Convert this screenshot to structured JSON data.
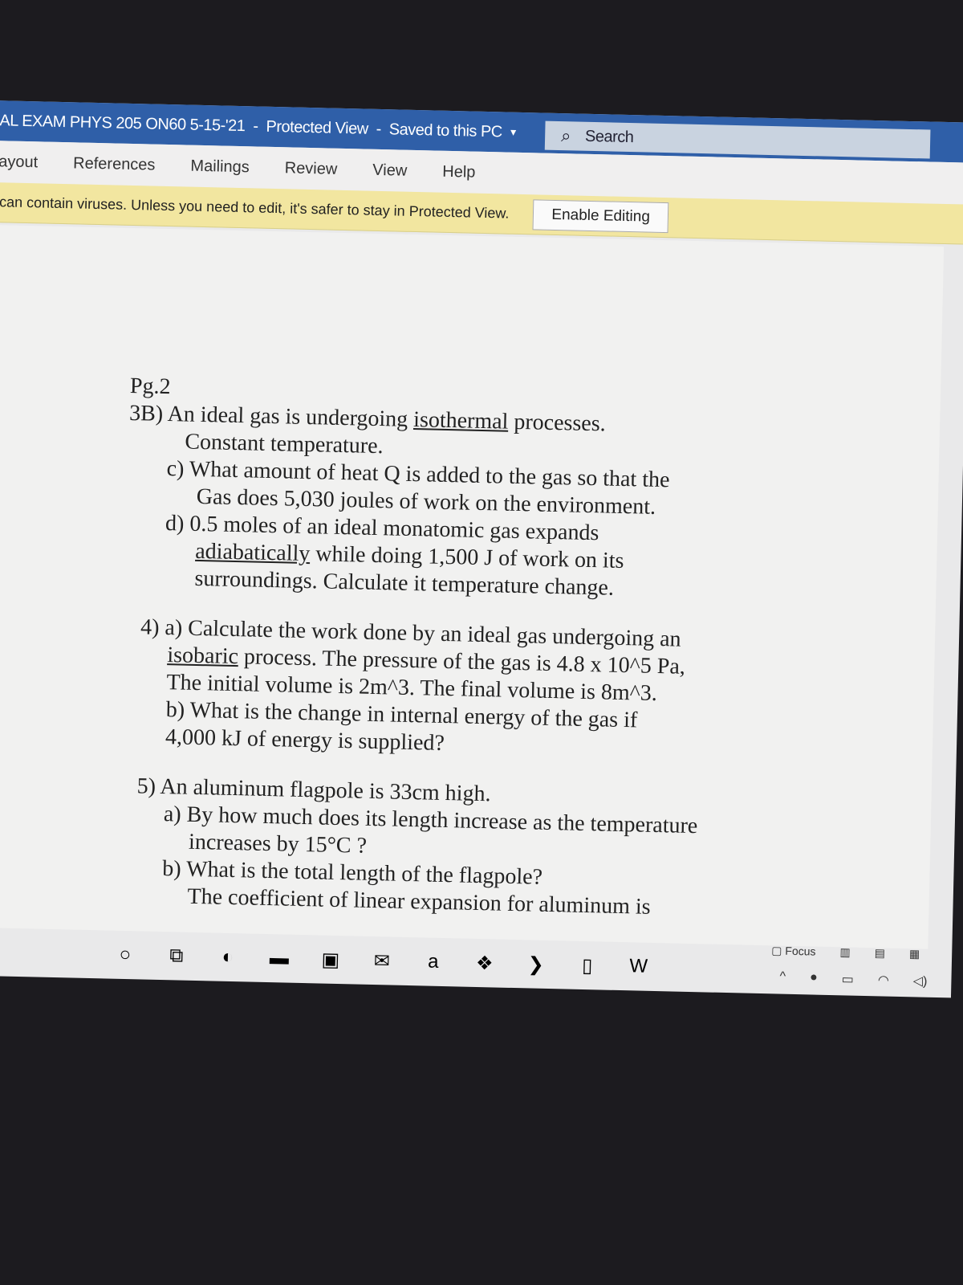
{
  "window": {
    "title": "AL EXAM PHYS 205 ON60 5-15-'21",
    "mode": "Protected View",
    "save_status": "Saved to this PC",
    "search_label": "Search"
  },
  "tabs": [
    "ayout",
    "References",
    "Mailings",
    "Review",
    "View",
    "Help"
  ],
  "protected_bar": {
    "message": "can contain viruses. Unless you need to edit, it's safer to stay in Protected View.",
    "button": "Enable Editing"
  },
  "document": {
    "lines": [
      {
        "t": "Pg.2",
        "c": ""
      },
      {
        "t": "3B) An ideal gas is undergoing isothermal processes.",
        "c": ""
      },
      {
        "t": "Constant temperature.",
        "c": "i1"
      },
      {
        "t": "c) What amount of heat Q is added to the gas so that the",
        "c": "i2"
      },
      {
        "t": "Gas does 5,030 joules of work on the environment.",
        "c": "i3"
      },
      {
        "t": "d) 0.5 moles of an ideal monatomic gas expands",
        "c": "i2"
      },
      {
        "t": "adiabatically while doing 1,500 J of work on its",
        "c": "i3"
      },
      {
        "t": "surroundings. Calculate it temperature change.",
        "c": "i3"
      },
      {
        "t": "",
        "c": "gap"
      },
      {
        "t": "4) a) Calculate the work done by an ideal gas undergoing an",
        "c": "i4"
      },
      {
        "t": "isobaric process. The pressure of the gas is 4.8 x 10^5 Pa,",
        "c": "i5"
      },
      {
        "t": "The initial volume is 2m^3. The final volume is 8m^3.",
        "c": "i5"
      },
      {
        "t": "b) What is the change in internal energy of the gas if",
        "c": "i5"
      },
      {
        "t": "4,000 kJ of energy is supplied?",
        "c": "i5"
      },
      {
        "t": "",
        "c": "gap"
      },
      {
        "t": "5) An aluminum flagpole is 33cm high.",
        "c": "i4"
      },
      {
        "t": "a) By how much does its length increase as the temperature",
        "c": "i5"
      },
      {
        "t": "increases by 15°C ?",
        "c": "i3"
      },
      {
        "t": "b) What is the total length of the flagpole?",
        "c": "i5"
      },
      {
        "t": "The coefficient of linear expansion for aluminum is",
        "c": "i3"
      }
    ]
  },
  "status": {
    "focus": "Focus"
  },
  "taskbar": [
    "cortana-icon",
    "task-view-icon",
    "edge-icon",
    "file-explorer-icon",
    "store-icon",
    "mail-icon",
    "amazon-icon",
    "dropbox-icon",
    "powershell-icon",
    "office-icon",
    "word-icon"
  ],
  "colors": {
    "titlebar": "#2f5fa8",
    "protected_bar": "#f2e6a0"
  }
}
